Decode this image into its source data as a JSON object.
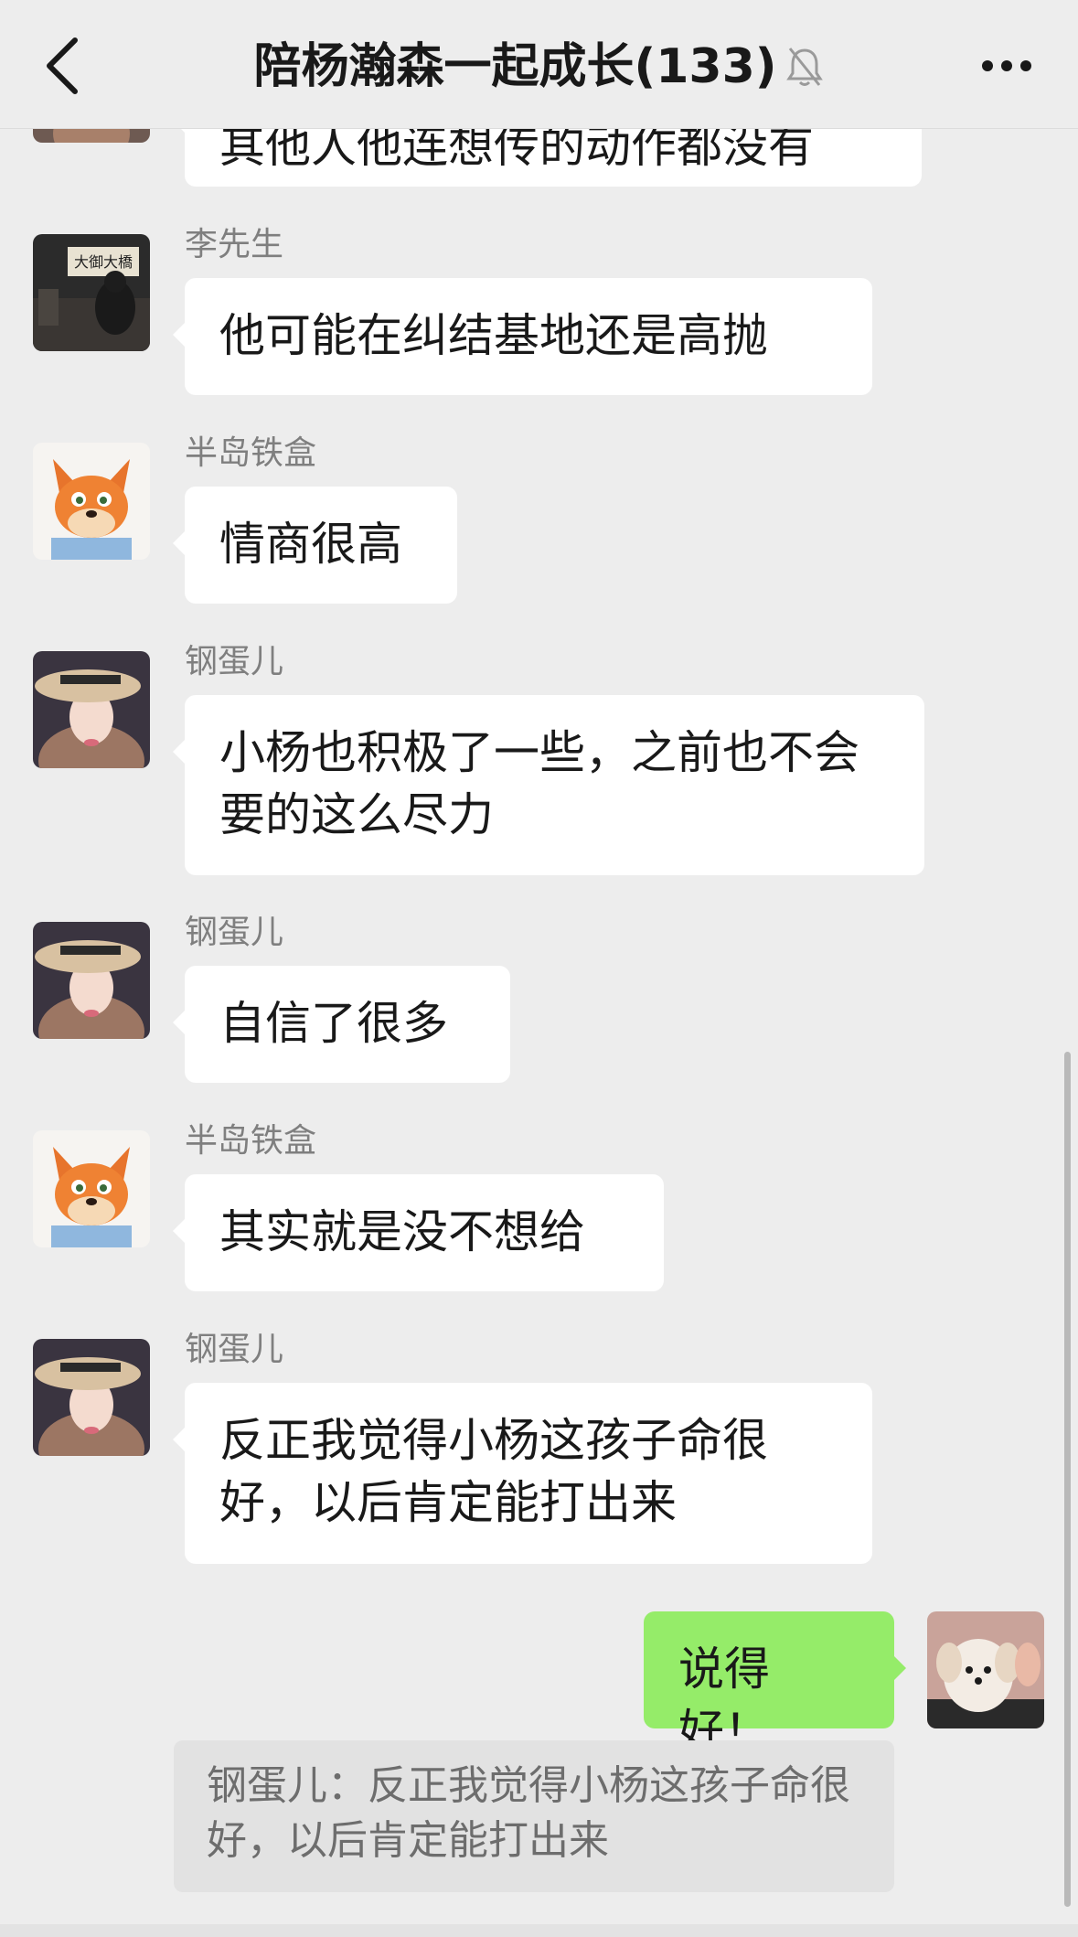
{
  "header": {
    "title": "陪杨瀚森一起成长(133)",
    "back_icon": "chevron-left-icon",
    "mute_icon": "bell-off-icon",
    "more_icon": "ellipsis-icon"
  },
  "partial_message": {
    "text": "其他人他连想传的动作都没有"
  },
  "messages": [
    {
      "sender": "李先生",
      "text": "他可能在纠结基地还是高抛",
      "avatar": "restaurant-photo-avatar"
    },
    {
      "sender": "半岛铁盒",
      "text": "情商很高",
      "avatar": "fox-cartoon-avatar"
    },
    {
      "sender": "钢蛋儿",
      "text": "小杨也积极了一些，之前也不会要的这么尽力",
      "avatar": "woman-hat-avatar"
    },
    {
      "sender": "钢蛋儿",
      "text": "自信了很多",
      "avatar": "woman-hat-avatar"
    },
    {
      "sender": "半岛铁盒",
      "text": "其实就是没不想给",
      "avatar": "fox-cartoon-avatar"
    },
    {
      "sender": "钢蛋儿",
      "text": "反正我觉得小杨这孩子命很好，以后肯定能打出来",
      "avatar": "woman-hat-avatar"
    }
  ],
  "my_message": {
    "text": "说得好！",
    "avatar": "puppy-avatar"
  },
  "quote": {
    "text": "钢蛋儿：反正我觉得小杨这孩子命很好，以后肯定能打出来"
  },
  "colors": {
    "background": "#ededed",
    "my_bubble": "#95ec69",
    "other_bubble": "#ffffff",
    "quote_bg": "#e2e2e2"
  }
}
